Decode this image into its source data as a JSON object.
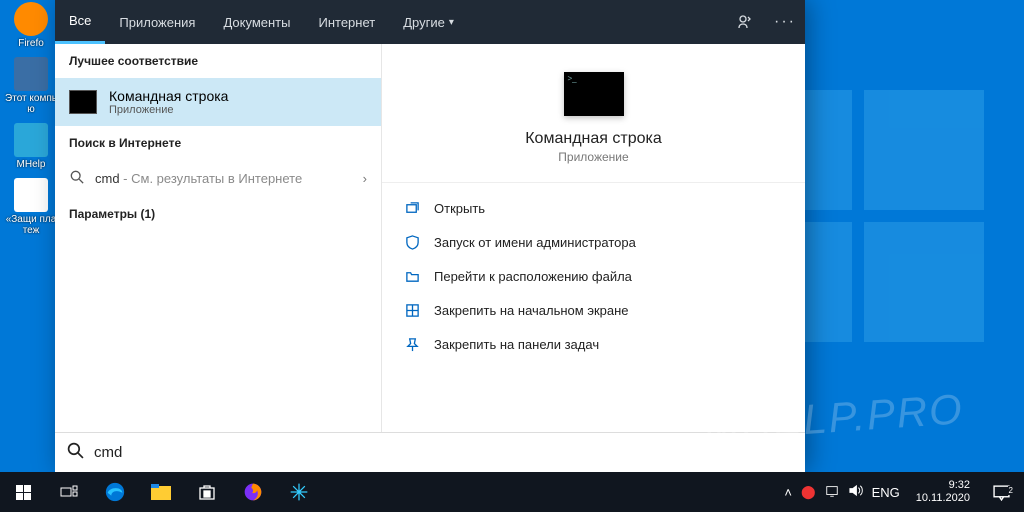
{
  "desktop": {
    "icons": [
      {
        "label": "Firefo"
      },
      {
        "label": "Этот компью"
      },
      {
        "label": "MHelp"
      },
      {
        "label": "«Защи платеж"
      }
    ]
  },
  "search_panel": {
    "tabs": {
      "items": [
        "Все",
        "Приложения",
        "Документы",
        "Интернет",
        "Другие"
      ],
      "active_index": 0
    },
    "sections": {
      "best_match_label": "Лучшее соответствие",
      "best_match": {
        "title": "Командная строка",
        "subtitle": "Приложение"
      },
      "web_label": "Поиск в Интернете",
      "web_item": {
        "query": "cmd",
        "suffix": " - См. результаты в Интернете"
      },
      "settings_label": "Параметры (1)"
    },
    "preview": {
      "title": "Командная строка",
      "subtitle": "Приложение",
      "actions": [
        {
          "icon": "open",
          "label": "Открыть"
        },
        {
          "icon": "admin",
          "label": "Запуск от имени администратора"
        },
        {
          "icon": "folder",
          "label": "Перейти к расположению файла"
        },
        {
          "icon": "pin-start",
          "label": "Закрепить на начальном экране"
        },
        {
          "icon": "pin-task",
          "label": "Закрепить на панели задач"
        }
      ]
    },
    "search_input": {
      "value": "cmd",
      "placeholder": ""
    }
  },
  "taskbar": {
    "tray": {
      "lang": "ENG",
      "chevron": "˄"
    },
    "clock": {
      "time": "9:32",
      "date": "10.11.2020"
    },
    "notifications": "2"
  },
  "watermark": "MHELP.PRO"
}
